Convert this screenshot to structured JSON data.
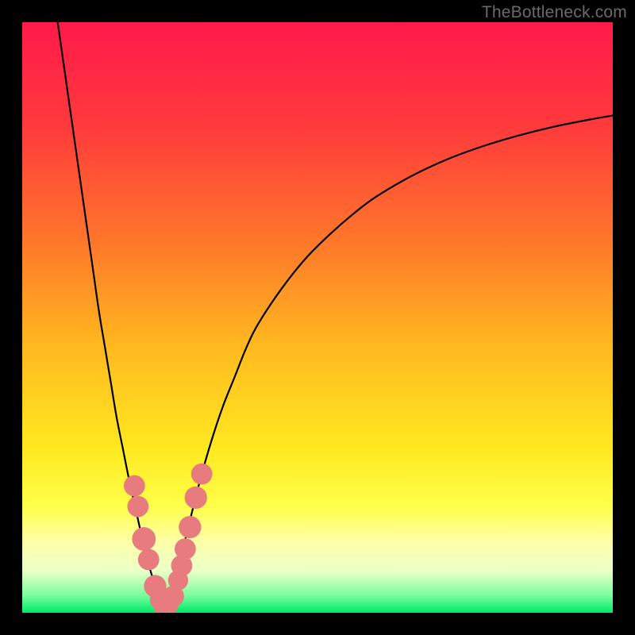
{
  "attribution": "TheBottleneck.com",
  "chart_data": {
    "type": "line",
    "title": "",
    "xlabel": "",
    "ylabel": "",
    "xlim": [
      0,
      100
    ],
    "ylim": [
      0,
      100
    ],
    "gradient_stops": [
      {
        "offset": 0.0,
        "color": "#ff1a4b"
      },
      {
        "offset": 0.18,
        "color": "#ff3b3b"
      },
      {
        "offset": 0.38,
        "color": "#ff7a2a"
      },
      {
        "offset": 0.55,
        "color": "#ffb91f"
      },
      {
        "offset": 0.72,
        "color": "#ffe81f"
      },
      {
        "offset": 0.82,
        "color": "#ffff4a"
      },
      {
        "offset": 0.88,
        "color": "#ffffa8"
      },
      {
        "offset": 0.93,
        "color": "#eaffc8"
      },
      {
        "offset": 0.97,
        "color": "#7bff9e"
      },
      {
        "offset": 1.0,
        "color": "#00e86b"
      }
    ],
    "series": [
      {
        "name": "left-branch",
        "x": [
          6,
          7,
          8,
          9,
          10,
          11,
          12,
          13,
          14,
          15,
          16,
          17,
          18,
          19,
          20,
          20.8,
          21.6,
          22.4,
          23.2,
          24
        ],
        "y": [
          100,
          93,
          86,
          79,
          72,
          65,
          58,
          51,
          45,
          39,
          33,
          28,
          23,
          18.5,
          14,
          10.5,
          7.5,
          5,
          2.8,
          1
        ]
      },
      {
        "name": "right-branch",
        "x": [
          24,
          25,
          26,
          27,
          28,
          30,
          32,
          34,
          36,
          38,
          40,
          44,
          48,
          52,
          56,
          60,
          66,
          72,
          78,
          84,
          90,
          96,
          100
        ],
        "y": [
          1,
          3,
          6,
          10,
          14,
          22,
          29,
          35,
          40,
          45,
          49,
          55,
          60,
          64,
          67.5,
          70.5,
          74,
          76.8,
          79,
          80.8,
          82.3,
          83.5,
          84.2
        ]
      }
    ],
    "markers": [
      {
        "x": 19.0,
        "y": 21.5,
        "r": 1.8
      },
      {
        "x": 19.6,
        "y": 18.0,
        "r": 1.8
      },
      {
        "x": 20.6,
        "y": 12.5,
        "r": 2.0
      },
      {
        "x": 21.4,
        "y": 9.0,
        "r": 1.8
      },
      {
        "x": 22.5,
        "y": 4.5,
        "r": 1.9
      },
      {
        "x": 23.2,
        "y": 2.2,
        "r": 1.6
      },
      {
        "x": 24.0,
        "y": 1.0,
        "r": 1.7
      },
      {
        "x": 24.8,
        "y": 1.3,
        "r": 1.6
      },
      {
        "x": 25.6,
        "y": 2.8,
        "r": 1.8
      },
      {
        "x": 26.4,
        "y": 5.5,
        "r": 1.7
      },
      {
        "x": 27.0,
        "y": 8.0,
        "r": 1.8
      },
      {
        "x": 27.6,
        "y": 10.8,
        "r": 1.8
      },
      {
        "x": 28.4,
        "y": 14.5,
        "r": 1.9
      },
      {
        "x": 29.4,
        "y": 19.5,
        "r": 1.9
      },
      {
        "x": 30.4,
        "y": 23.5,
        "r": 1.8
      }
    ],
    "marker_color": "#e77b7e",
    "curve_color": "#000000",
    "curve_width": 2.2
  }
}
